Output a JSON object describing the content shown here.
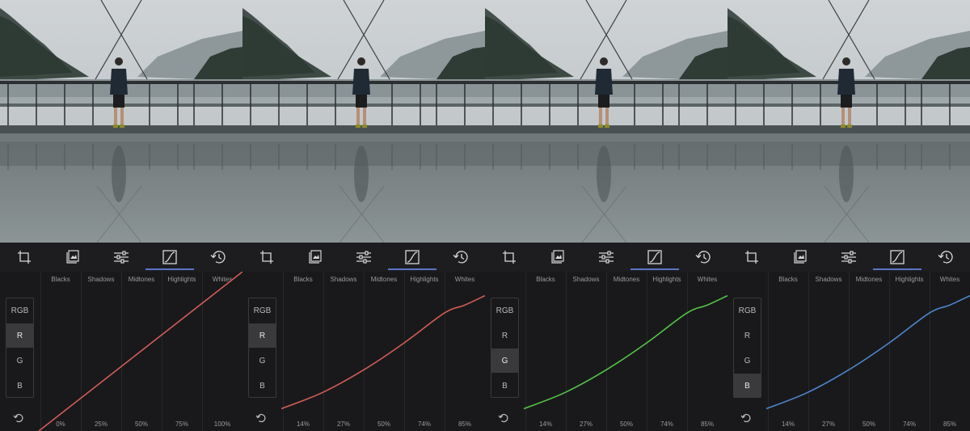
{
  "panels": [
    {
      "selected_channel": "R",
      "curve_color": "#d35c57",
      "percentages": [
        "0%",
        "25%",
        "50%",
        "75%",
        "100%"
      ],
      "curve_points": [
        [
          0,
          0
        ],
        [
          1,
          1
        ]
      ]
    },
    {
      "selected_channel": "R",
      "curve_color": "#d35c57",
      "percentages": [
        "14%",
        "27%",
        "50%",
        "74%",
        "85%"
      ],
      "curve_points": [
        [
          0,
          0.14
        ],
        [
          0.2,
          0.24
        ],
        [
          0.4,
          0.38
        ],
        [
          0.6,
          0.55
        ],
        [
          0.8,
          0.74
        ],
        [
          0.9,
          0.79
        ],
        [
          1,
          0.85
        ]
      ]
    },
    {
      "selected_channel": "G",
      "curve_color": "#52c646",
      "percentages": [
        "14%",
        "27%",
        "50%",
        "74%",
        "85%"
      ],
      "curve_points": [
        [
          0,
          0.14
        ],
        [
          0.2,
          0.24
        ],
        [
          0.4,
          0.38
        ],
        [
          0.6,
          0.55
        ],
        [
          0.8,
          0.74
        ],
        [
          0.9,
          0.79
        ],
        [
          1,
          0.85
        ]
      ]
    },
    {
      "selected_channel": "B",
      "curve_color": "#4d86d0",
      "percentages": [
        "14%",
        "27%",
        "50%",
        "74%",
        "85%"
      ],
      "curve_points": [
        [
          0,
          0.14
        ],
        [
          0.2,
          0.24
        ],
        [
          0.4,
          0.38
        ],
        [
          0.6,
          0.55
        ],
        [
          0.8,
          0.74
        ],
        [
          0.9,
          0.79
        ],
        [
          1,
          0.85
        ]
      ]
    }
  ],
  "zones": [
    "Blacks",
    "Shadows",
    "Midtones",
    "Highlights",
    "Whites"
  ],
  "channels": [
    "RGB",
    "R",
    "G",
    "B"
  ],
  "toolbar": {
    "icons": [
      "crop-icon",
      "filters-icon",
      "adjust-icon",
      "curves-icon",
      "history-icon"
    ],
    "active": "curves-icon",
    "accent_color": "#5b74c6"
  },
  "photo": {
    "description_colors": {
      "sky": "#c9ced1",
      "water": "#7d878b",
      "deck": "#7e8788"
    }
  }
}
